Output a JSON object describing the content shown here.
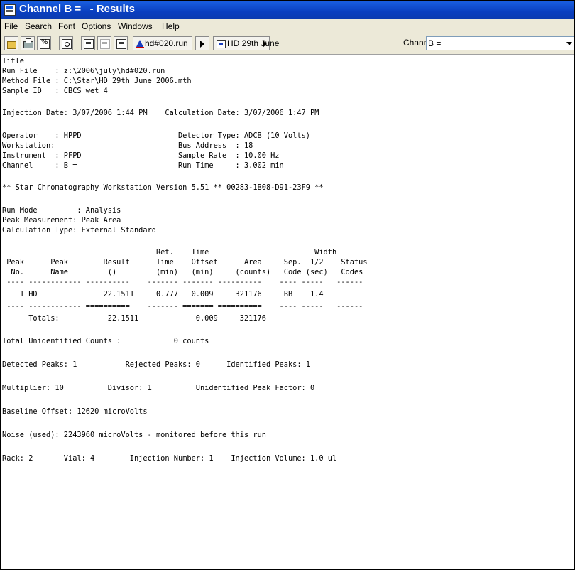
{
  "window": {
    "title": "Channel B =   - Results"
  },
  "menu": {
    "items": [
      "File",
      "Search",
      "Font",
      "Options",
      "Windows",
      "Help"
    ]
  },
  "toolbar": {
    "run_selector": "hd#020.run",
    "method_selector": "HD 29th June",
    "channel_label": "Channel:",
    "channel_value": "B ="
  },
  "report": {
    "header": [
      "Title",
      "Run File    : z:\\2006\\july\\hd#020.run",
      "Method File : C:\\Star\\HD 29th June 2006.mth",
      "Sample ID   : CBCS wet 4"
    ],
    "injection_line": "Injection Date: 3/07/2006 1:44 PM    Calculation Date: 3/07/2006 1:47 PM",
    "info": [
      "Operator    : HPPD                      Detector Type: ADCB (10 Volts)",
      "Workstation:                            Bus Address  : 18",
      "Instrument  : PFPD                      Sample Rate  : 10.00 Hz",
      "Channel     : B =                       Run Time     : 3.002 min"
    ],
    "version_line": "** Star Chromatography Workstation Version 5.51 ** 00283-1B08-D91-23F9 **",
    "mode": [
      "Run Mode         : Analysis",
      "Peak Measurement: Peak Area",
      "Calculation Type: External Standard"
    ],
    "table_header": [
      "                                   Ret.    Time                        Width",
      " Peak      Peak        Result      Time    Offset      Area     Sep.  1/2    Status",
      "  No.      Name         ()         (min)   (min)     (counts)   Code (sec)   Codes",
      " ---- ------------ ----------    ------- ------- ----------    ---- -----   ------"
    ],
    "table_rows": [
      "    1 HD               22.1511     0.777   0.009     321176     BB    1.4"
    ],
    "table_sep": " ---- ------------ ==========    ------- ======= ==========    ---- -----   ------",
    "totals_line": "      Totals:           22.1511             0.009     321176",
    "unidentified": "Total Unidentified Counts :            0 counts",
    "peaks_line": "Detected Peaks: 1           Rejected Peaks: 0      Identified Peaks: 1",
    "multiplier_line": "Multiplier: 10          Divisor: 1          Unidentified Peak Factor: 0",
    "baseline": "Baseline Offset: 12620 microVolts",
    "noise": "Noise (used): 2243960 microVolts - monitored before this run",
    "rack_line": "Rack: 2       Vial: 4        Injection Number: 1    Injection Volume: 1.0 ul"
  }
}
